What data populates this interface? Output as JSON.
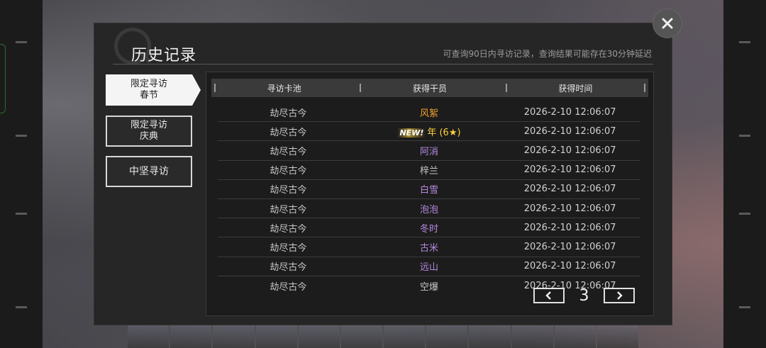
{
  "dialog": {
    "title": "历史记录",
    "notice": "可查询90日内寻访记录，查询结果可能存在30分钟延迟"
  },
  "tabs": [
    {
      "line1": "限定寻访",
      "line2": "春节",
      "active": true
    },
    {
      "line1": "限定寻访",
      "line2": "庆典",
      "active": false
    },
    {
      "line1": "中坚寻访",
      "line2": "",
      "active": false
    }
  ],
  "table": {
    "headers": [
      "寻访卡池",
      "获得干员",
      "获得时间"
    ],
    "rows": [
      {
        "pool": "劫尽古今",
        "operator": "风絮",
        "time": "2026-2-10 12:06:07",
        "color": "#f0a030"
      },
      {
        "pool": "劫尽古今",
        "operator": "年 (6★)",
        "time": "2026-2-10 12:06:07",
        "color": "#ffd23c",
        "new_tag": "NEW!"
      },
      {
        "pool": "劫尽古今",
        "operator": "阿消",
        "time": "2026-2-10 12:06:07",
        "color": "#b58ae0"
      },
      {
        "pool": "劫尽古今",
        "operator": "梓兰",
        "time": "2026-2-10 12:06:07",
        "color": "#c8c8c8"
      },
      {
        "pool": "劫尽古今",
        "operator": "白雪",
        "time": "2026-2-10 12:06:07",
        "color": "#b58ae0"
      },
      {
        "pool": "劫尽古今",
        "operator": "泡泡",
        "time": "2026-2-10 12:06:07",
        "color": "#b58ae0"
      },
      {
        "pool": "劫尽古今",
        "operator": "冬时",
        "time": "2026-2-10 12:06:07",
        "color": "#b58ae0"
      },
      {
        "pool": "劫尽古今",
        "operator": "古米",
        "time": "2026-2-10 12:06:07",
        "color": "#b58ae0"
      },
      {
        "pool": "劫尽古今",
        "operator": "远山",
        "time": "2026-2-10 12:06:07",
        "color": "#b58ae0"
      },
      {
        "pool": "劫尽古今",
        "operator": "空爆",
        "time": "2026-2-10 12:06:07",
        "color": "#c8c8c8"
      }
    ]
  },
  "pager": {
    "page": "3",
    "prev_icon": "chevron-left-icon",
    "next_icon": "chevron-right-icon"
  },
  "close_icon": "close-icon"
}
